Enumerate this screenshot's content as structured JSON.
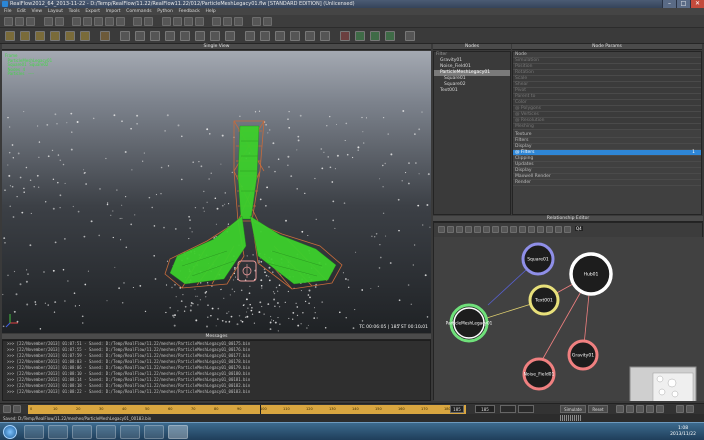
{
  "window": {
    "title": "RealFlow2012_64_2013-11-22 - D:/Temp/RealFlow/11.22/RealFlow11.22/012/ParticleMeshLegacy01.flw [STANDARD EDITION] (Unlicensed)",
    "minimize": "–",
    "maximize": "□",
    "close": "✕"
  },
  "menu": [
    "File",
    "Edit",
    "View",
    "Layout",
    "Tools",
    "Export",
    "Import",
    "Commands",
    "Python",
    "Feedback",
    "Help"
  ],
  "viewport": {
    "title": "Single View",
    "stats": "Frame\n  ParticleMeshLegacy01\n  Square01  Square02\n  Nodes  4\n  Particles   ----",
    "coords": "TC 00:06:05  |  185  ST 00:10:01"
  },
  "nodes": {
    "title": "Nodes",
    "filter_label": "Filter",
    "items": [
      "Gravity01",
      "Noise_Field01",
      "ParticleMeshLegacy01",
      "Square01",
      "Square02",
      "Text001"
    ]
  },
  "params": {
    "title": "Node Params",
    "section_label": "Node",
    "rows": [
      "Node",
      "Simulation",
      "Position",
      "Rotation",
      "Scale",
      "Shear",
      "Pivot",
      "Parent to",
      "Color",
      "@ Polygons",
      "@ Vertices",
      "@ Resolution",
      "Meshing",
      "Texture",
      "Filters",
      "Display",
      "Statistics"
    ],
    "groups": [
      "Texture",
      "Filters",
      "Display",
      "@ Filters",
      "Clipping",
      "Updates",
      "Display",
      "Maxwell Render",
      "Render"
    ],
    "selected_value": "1"
  },
  "relationship": {
    "title": "Relationship Editor",
    "toolbar_label": "Q4",
    "nodes": [
      {
        "label": "Square01",
        "color": "#8f8fe8"
      },
      {
        "label": "Hub01",
        "color": "#ffffff"
      },
      {
        "label": "Text001",
        "color": "#e8e07a"
      },
      {
        "label": "ParticleMeshLegacy01",
        "color": "#6fe07a"
      },
      {
        "label": "Gravity01",
        "color": "#f08080"
      },
      {
        "label": "Noise_Field01",
        "color": "#f08080"
      }
    ]
  },
  "messages": {
    "title": "Messages",
    "lines": [
      ">>> [22/November/2013] 01:07:51 - Saved: D:/Temp/RealFlow/11.22/meshes/ParticleMeshLegacy01_00175.bin",
      ">>> [22/November/2013] 01:07:55 - Saved: D:/Temp/RealFlow/11.22/meshes/ParticleMeshLegacy01_00176.bin",
      ">>> [22/November/2013] 01:07:59 - Saved: D:/Temp/RealFlow/11.22/meshes/ParticleMeshLegacy01_00177.bin",
      ">>> [22/November/2013] 01:08:03 - Saved: D:/Temp/RealFlow/11.22/meshes/ParticleMeshLegacy01_00178.bin",
      ">>> [22/November/2013] 01:08:06 - Saved: D:/Temp/RealFlow/11.22/meshes/ParticleMeshLegacy01_00179.bin",
      ">>> [22/November/2013] 01:08:10 - Saved: D:/Temp/RealFlow/11.22/meshes/ParticleMeshLegacy01_00180.bin",
      ">>> [22/November/2013] 01:08:14 - Saved: D:/Temp/RealFlow/11.22/meshes/ParticleMeshLegacy01_00181.bin",
      ">>> [22/November/2013] 01:08:18 - Saved: D:/Temp/RealFlow/11.22/meshes/ParticleMeshLegacy01_00182.bin",
      ">>> [22/November/2013] 01:08:22 - Saved: D:/Temp/RealFlow/11.22/meshes/ParticleMeshLegacy01_00183.bin"
    ]
  },
  "timeline": {
    "ticks": [
      "0",
      "10",
      "20",
      "30",
      "40",
      "50",
      "60",
      "70",
      "80",
      "90",
      "100",
      "110",
      "120",
      "130",
      "140",
      "150",
      "160",
      "170",
      "180"
    ],
    "current_frame": "185",
    "end_frame": "185",
    "mode_button": "Simulate",
    "reset_button": "Reset"
  },
  "status": {
    "text": "Saved: D:/Temp/RealFlow/11.22/meshes/ParticleMeshLegacy01_00183.bin"
  },
  "taskbar": {
    "time": "1:08",
    "date": "2013/11/22"
  },
  "colors": {
    "mesh_green": "#3ccf2c",
    "wire_orange": "#c76b3b",
    "selection_blue": "#2e86d6",
    "timeline_gold": "#d9a640"
  }
}
